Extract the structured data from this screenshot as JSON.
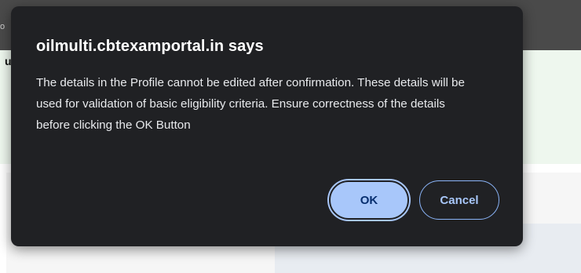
{
  "background": {
    "topbar_char": "o",
    "band_char": "u"
  },
  "dialog": {
    "title": "oilmulti.cbtexamportal.in says",
    "message": "The details in the Profile cannot be edited after confirmation. These details will be used for validation of basic eligibility criteria. Ensure correctness of the details before clicking the OK Button",
    "ok_label": "OK",
    "cancel_label": "Cancel"
  },
  "colors": {
    "dialog_bg": "#202124",
    "accent": "#a8c7fa"
  }
}
